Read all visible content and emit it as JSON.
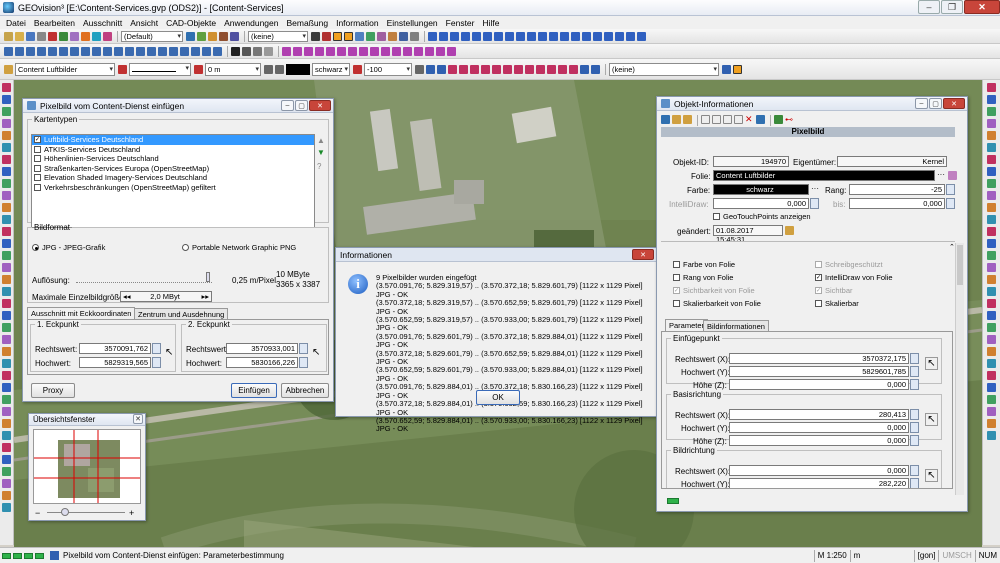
{
  "app": {
    "title": "GEOvision³ [E:\\Content-Services.gvp (ODS2)] - [Content-Services]"
  },
  "menu": [
    "Datei",
    "Bearbeiten",
    "Ausschnitt",
    "Ansicht",
    "CAD-Objekte",
    "Anwendungen",
    "Bemaßung",
    "Information",
    "Einstellungen",
    "Fenster",
    "Hilfe"
  ],
  "toolbar": {
    "layer_combo": "(Default)",
    "style_combo": "(keine)",
    "folie_combo": "Content Luftbilder",
    "distance": "0 m",
    "color_name": "schwarz",
    "zvalue": "-100",
    "symbol_combo": "(keine)"
  },
  "pixelbild_dialog": {
    "title": "Pixelbild vom Content-Dienst einfügen",
    "kartentypen_label": "Kartentypen",
    "kartentypen": [
      {
        "label": "Luftbild-Services Deutschland",
        "checked": true,
        "selected": true
      },
      {
        "label": "ATKIS-Services Deutschland",
        "checked": false,
        "selected": false
      },
      {
        "label": "Höhenlinien-Services Deutschland",
        "checked": false,
        "selected": false
      },
      {
        "label": "Straßenkarten-Services Europa (OpenStreetMap)",
        "checked": false,
        "selected": false
      },
      {
        "label": "Elevation Shaded Imagery-Services Deutschland",
        "checked": false,
        "selected": false
      },
      {
        "label": "Verkehrsbeschränkungen (OpenStreetMap) gefiltert",
        "checked": false,
        "selected": false
      }
    ],
    "bildformat_label": "Bildformat",
    "format_jpg": "JPG - JPEG-Grafik",
    "format_png": "Portable Network Graphic PNG",
    "aufloesung_label": "Auflösung:",
    "aufloesung_value": "0,25 m/Pixel",
    "size_mb": "10 MByte",
    "size_px": "3365 x 3387",
    "max_label": "Maximale Einzelbildgröße",
    "max_value": "2,0 MByt",
    "tab1": "Ausschnitt mit Eckkoordinaten",
    "tab2": "Zentrum und Ausdehnung",
    "eck1_label": "1. Eckpunkt",
    "eck2_label": "2. Eckpunkt",
    "rechtswert_label": "Rechtswert:",
    "hochwert_label": "Hochwert:",
    "eck1_rechts": "3570091,762",
    "eck1_hoch": "5829319,565",
    "eck2_rechts": "3570933,001",
    "eck2_hoch": "5830166,226",
    "proxy": "Proxy",
    "einfuegen": "Einfügen",
    "abbrechen": "Abbrechen"
  },
  "overview": {
    "title": "Übersichtsfenster",
    "minus": "−",
    "plus": "+"
  },
  "info_dialog": {
    "title": "Informationen",
    "header": "9 Pixelbilder wurden eingefügt",
    "lines": [
      "(3.570.091,76; 5.829.319,57) .. (3.570.372,18; 5.829.601,79) [1122 x 1129 Pixel] JPG - OK",
      "(3.570.372,18; 5.829.319,57) .. (3.570.652,59; 5.829.601,79) [1122 x 1129 Pixel] JPG - OK",
      "(3.570.652,59; 5.829.319,57) .. (3.570.933,00; 5.829.601,79) [1122 x 1129 Pixel] JPG - OK",
      "(3.570.091,76; 5.829.601,79) .. (3.570.372,18; 5.829.884,01) [1122 x 1129 Pixel] JPG - OK",
      "(3.570.372,18; 5.829.601,79) .. (3.570.652,59; 5.829.884,01) [1122 x 1129 Pixel] JPG - OK",
      "(3.570.652,59; 5.829.601,79) .. (3.570.933,00; 5.829.884,01) [1122 x 1129 Pixel] JPG - OK",
      "(3.570.091,76; 5.829.884,01) .. (3.570.372,18; 5.830.166,23) [1122 x 1129 Pixel] JPG - OK",
      "(3.570.372,18; 5.829.884,01) .. (3.570.652,59; 5.830.166,23) [1122 x 1129 Pixel] JPG - OK",
      "(3.570.652,59; 5.829.884,01) .. (3.570.933,00; 5.830.166,23) [1122 x 1129 Pixel] JPG - OK"
    ],
    "ok": "OK"
  },
  "objinfo": {
    "title": "Objekt-Informationen",
    "section": "Pixelbild",
    "objekt_id_label": "Objekt-ID:",
    "objekt_id": "194970",
    "eigentuemer_label": "Eigentümer:",
    "eigentuemer": "Kernel",
    "folie_label": "Folie:",
    "folie": "Content Luftbilder",
    "farbe_label": "Farbe:",
    "farbe": "schwarz",
    "rang_label": "Rang:",
    "rang": "-25",
    "intellidraw_label": "IntelliDraw:",
    "intellidraw": "0,000",
    "bis_label": "bis:",
    "bis": "0,000",
    "geotouch": "GeoTouchPoints anzeigen",
    "geaendert_label": "geändert:",
    "geaendert": "01.08.2017 15:45:31",
    "checks_left": [
      "Farbe von Folie",
      "Rang von Folie",
      "Sichtbarkeit von Folie",
      "Skalierbarkeit von Folie"
    ],
    "checks_right": [
      "Schreibgeschützt",
      "IntelliDraw von Folie",
      "Sichtbar",
      "Skalierbar"
    ],
    "tab_param": "Parameter",
    "tab_bild": "Bildinformationen",
    "einfuegepunkt_label": "Einfügepunkt",
    "basisrichtung_label": "Basisrichtung",
    "bildrichtung_label": "Bildrichtung",
    "rechts_x_label": "Rechtswert (X):",
    "hoch_y_label": "Hochwert (Y):",
    "hoehe_z_label": "Höhe (Z):",
    "ep_x": "3570372,175",
    "ep_y": "5829601,785",
    "ep_z": "0,000",
    "br_x": "280,413",
    "br_y": "0,000",
    "br_z": "0,000",
    "bi_x": "0,000",
    "bi_y": "282,220"
  },
  "status": {
    "message": "Pixelbild vom Content-Dienst einfügen: Parameterbestimmung",
    "scale": "M 1:250",
    "unit": "m",
    "gon": "[gon]",
    "umsch": "UMSCH",
    "num": "NUM"
  },
  "colors": {
    "selection_blue": "#3399ff",
    "section_header": "#a8b2c0",
    "folie_black": "#000000"
  }
}
